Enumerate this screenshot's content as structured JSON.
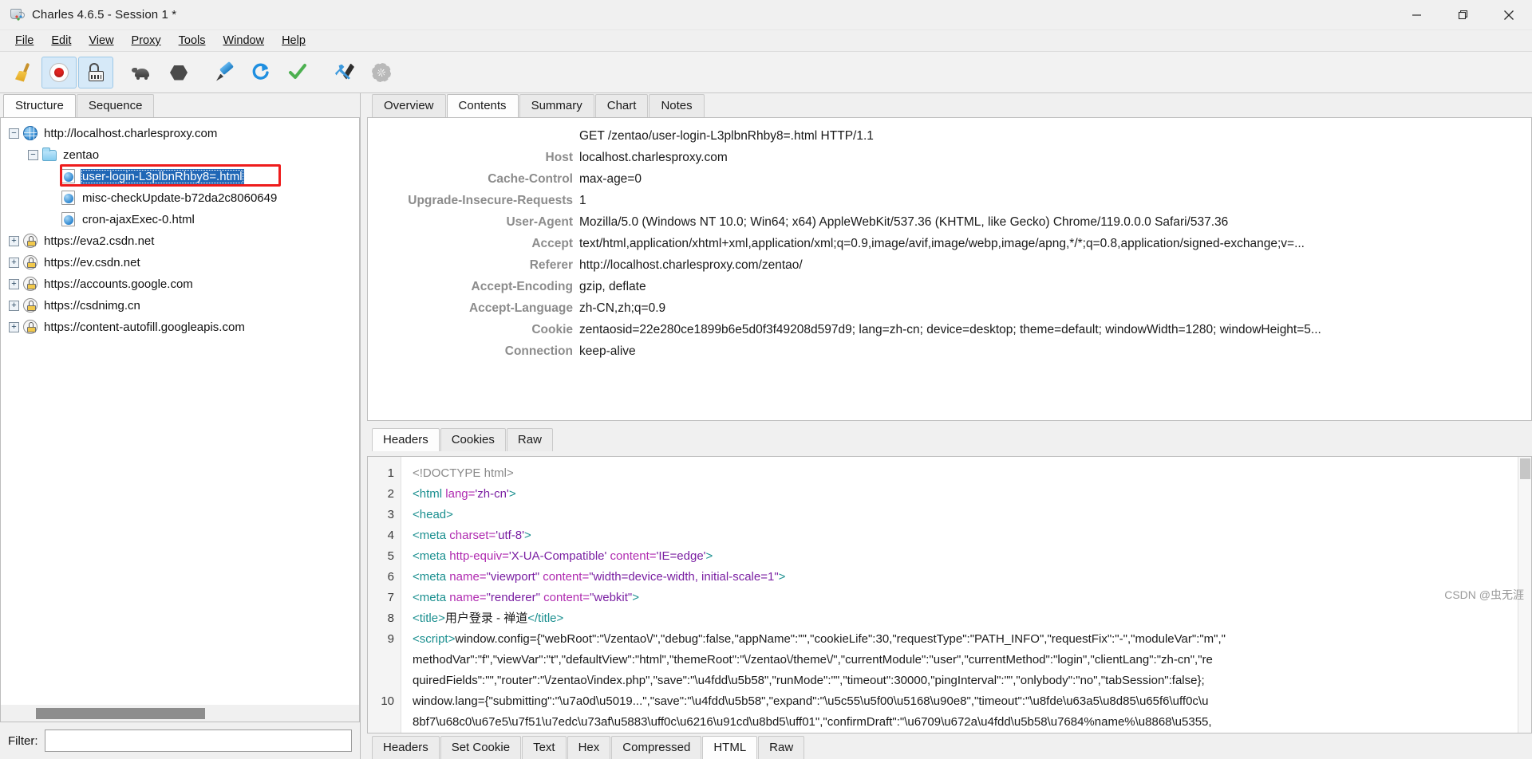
{
  "window": {
    "title": "Charles 4.6.5 - Session 1 *",
    "app_icon": "charles-cup-icon",
    "minimize_label": "Minimize",
    "maximize_label": "Restore",
    "close_label": "Close"
  },
  "menubar": [
    {
      "label": "File",
      "mnemonic": "F"
    },
    {
      "label": "Edit",
      "mnemonic": "E"
    },
    {
      "label": "View",
      "mnemonic": "V"
    },
    {
      "label": "Proxy",
      "mnemonic": "P"
    },
    {
      "label": "Tools",
      "mnemonic": "T"
    },
    {
      "label": "Window",
      "mnemonic": "W"
    },
    {
      "label": "Help",
      "mnemonic": "H"
    }
  ],
  "toolbar": [
    {
      "name": "clear-session-icon",
      "tip": "Clear the current session"
    },
    {
      "name": "record-icon",
      "tip": "Start/Stop Recording",
      "selected": true
    },
    {
      "name": "breakpoints-icon",
      "tip": "Enable/Disable Breakpoints",
      "selected": true
    },
    {
      "name": "throttle-icon",
      "tip": "Start/Stop Throttling"
    },
    {
      "name": "no-caching-icon",
      "tip": "Compose"
    },
    {
      "name": "compose-icon",
      "tip": "Compose a new request"
    },
    {
      "name": "repeat-icon",
      "tip": "Repeat the selected request"
    },
    {
      "name": "validate-icon",
      "tip": "Validate"
    },
    {
      "name": "tools-icon",
      "tip": "Tools"
    },
    {
      "name": "settings-icon",
      "tip": "Settings"
    }
  ],
  "left_panel": {
    "tabs": [
      {
        "label": "Structure",
        "active": true
      },
      {
        "label": "Sequence",
        "active": false
      }
    ],
    "tree": [
      {
        "label": "http://localhost.charlesproxy.com",
        "icon": "globe-icon",
        "twisty": "minus",
        "indent": 0,
        "selected": false,
        "highlighted": false
      },
      {
        "label": "zentao",
        "icon": "folder-icon",
        "twisty": "minus",
        "indent": 1,
        "selected": false,
        "highlighted": false
      },
      {
        "label": "user-login-L3plbnRhby8=.html",
        "icon": "file-icon",
        "twisty": "none",
        "indent": 2,
        "selected": true,
        "highlighted": true
      },
      {
        "label": "misc-checkUpdate-b72da2c8060649",
        "icon": "file-icon",
        "twisty": "none",
        "indent": 2,
        "selected": false,
        "highlighted": false
      },
      {
        "label": "cron-ajaxExec-0.html",
        "icon": "file-icon",
        "twisty": "none",
        "indent": 2,
        "selected": false,
        "highlighted": false
      },
      {
        "label": "https://eva2.csdn.net",
        "icon": "ssl-icon",
        "twisty": "plus",
        "indent": 0,
        "selected": false,
        "highlighted": false
      },
      {
        "label": "https://ev.csdn.net",
        "icon": "ssl-icon",
        "twisty": "plus",
        "indent": 0,
        "selected": false,
        "highlighted": false
      },
      {
        "label": "https://accounts.google.com",
        "icon": "ssl-icon",
        "twisty": "plus",
        "indent": 0,
        "selected": false,
        "highlighted": false
      },
      {
        "label": "https://csdnimg.cn",
        "icon": "ssl-icon",
        "twisty": "plus",
        "indent": 0,
        "selected": false,
        "highlighted": false
      },
      {
        "label": "https://content-autofill.googleapis.com",
        "icon": "ssl-icon",
        "twisty": "plus",
        "indent": 0,
        "selected": false,
        "highlighted": false
      }
    ],
    "filter": {
      "label": "Filter:",
      "value": "",
      "placeholder": ""
    }
  },
  "right_panel": {
    "main_tabs": [
      {
        "label": "Overview",
        "active": false
      },
      {
        "label": "Contents",
        "active": true
      },
      {
        "label": "Summary",
        "active": false
      },
      {
        "label": "Chart",
        "active": false
      },
      {
        "label": "Notes",
        "active": false
      }
    ],
    "request_line": "GET /zentao/user-login-L3plbnRhby8=.html HTTP/1.1",
    "headers": [
      {
        "name": "Host",
        "value": "localhost.charlesproxy.com"
      },
      {
        "name": "Cache-Control",
        "value": "max-age=0"
      },
      {
        "name": "Upgrade-Insecure-Requests",
        "value": "1"
      },
      {
        "name": "User-Agent",
        "value": "Mozilla/5.0 (Windows NT 10.0; Win64; x64) AppleWebKit/537.36 (KHTML, like Gecko) Chrome/119.0.0.0 Safari/537.36"
      },
      {
        "name": "Accept",
        "value": "text/html,application/xhtml+xml,application/xml;q=0.9,image/avif,image/webp,image/apng,*/*;q=0.8,application/signed-exchange;v=..."
      },
      {
        "name": "Referer",
        "value": "http://localhost.charlesproxy.com/zentao/"
      },
      {
        "name": "Accept-Encoding",
        "value": "gzip, deflate"
      },
      {
        "name": "Accept-Language",
        "value": "zh-CN,zh;q=0.9"
      },
      {
        "name": "Cookie",
        "value": "zentaosid=22e280ce1899b6e5d0f3f49208d597d9; lang=zh-cn; device=desktop; theme=default; windowWidth=1280; windowHeight=5..."
      },
      {
        "name": "Connection",
        "value": "keep-alive"
      }
    ],
    "request_subtabs": [
      {
        "label": "Headers",
        "active": true
      },
      {
        "label": "Cookies",
        "active": false
      },
      {
        "label": "Raw",
        "active": false
      }
    ],
    "response_subtabs": [
      {
        "label": "Headers",
        "active": false
      },
      {
        "label": "Set Cookie",
        "active": false
      },
      {
        "label": "Text",
        "active": false
      },
      {
        "label": "Hex",
        "active": false
      },
      {
        "label": "Compressed",
        "active": false
      },
      {
        "label": "HTML",
        "active": true
      },
      {
        "label": "Raw",
        "active": false
      }
    ],
    "code_lines": [
      {
        "num": "1",
        "segments": [
          {
            "t": "<!DOCTYPE html>",
            "c": "gy"
          }
        ]
      },
      {
        "num": "2",
        "segments": [
          {
            "t": "<html ",
            "c": "tg"
          },
          {
            "t": "lang=",
            "c": "at"
          },
          {
            "t": "'zh-cn'",
            "c": "st"
          },
          {
            "t": ">",
            "c": "tg"
          }
        ]
      },
      {
        "num": "3",
        "segments": [
          {
            "t": "<head>",
            "c": "tg"
          }
        ]
      },
      {
        "num": "4",
        "segments": [
          {
            "t": "  <meta ",
            "c": "tg"
          },
          {
            "t": "charset=",
            "c": "at"
          },
          {
            "t": "'utf-8'",
            "c": "st"
          },
          {
            "t": ">",
            "c": "tg"
          }
        ]
      },
      {
        "num": "5",
        "segments": [
          {
            "t": " <meta ",
            "c": "tg"
          },
          {
            "t": "http-equiv=",
            "c": "at"
          },
          {
            "t": "'X-UA-Compatible'",
            "c": "st"
          },
          {
            "t": " content=",
            "c": "at"
          },
          {
            "t": "'IE=edge'",
            "c": "st"
          },
          {
            "t": ">",
            "c": "tg"
          }
        ]
      },
      {
        "num": "6",
        "segments": [
          {
            "t": " <meta ",
            "c": "tg"
          },
          {
            "t": "name=",
            "c": "at"
          },
          {
            "t": "\"viewport\"",
            "c": "st"
          },
          {
            "t": " content=",
            "c": "at"
          },
          {
            "t": "\"width=device-width, initial-scale=1\"",
            "c": "st"
          },
          {
            "t": ">",
            "c": "tg"
          }
        ]
      },
      {
        "num": "7",
        "segments": [
          {
            "t": " <meta ",
            "c": "tg"
          },
          {
            "t": "name=",
            "c": "at"
          },
          {
            "t": "\"renderer\"",
            "c": "st"
          },
          {
            "t": " content=",
            "c": "at"
          },
          {
            "t": "\"webkit\"",
            "c": "st"
          },
          {
            "t": ">",
            "c": "tg"
          }
        ]
      },
      {
        "num": "8",
        "segments": [
          {
            "t": " <title>",
            "c": "tg"
          },
          {
            "t": "用户登录 - 禅道",
            "c": "pl"
          },
          {
            "t": "</title>",
            "c": "tg"
          }
        ]
      },
      {
        "num": "9",
        "segments": [
          {
            "t": "<script>",
            "c": "tg"
          },
          {
            "t": "window.config={\"webRoot\":\"\\/zentao\\/\",\"debug\":false,\"appName\":\"\",\"cookieLife\":30,\"requestType\":\"PATH_INFO\",\"requestFix\":\"-\",\"moduleVar\":\"m\",\"",
            "c": "pl"
          }
        ]
      },
      {
        "num": "",
        "segments": [
          {
            "t": "methodVar\":\"f\",\"viewVar\":\"t\",\"defaultView\":\"html\",\"themeRoot\":\"\\/zentao\\/theme\\/\",\"currentModule\":\"user\",\"currentMethod\":\"login\",\"clientLang\":\"zh-cn\",\"re",
            "c": "pl"
          }
        ]
      },
      {
        "num": "",
        "segments": [
          {
            "t": "quiredFields\":\"\",\"router\":\"\\/zentao\\/index.php\",\"save\":\"\\u4fdd\\u5b58\",\"runMode\":\"\",\"timeout\":30000,\"pingInterval\":\"\",\"onlybody\":\"no\",\"tabSession\":false};",
            "c": "pl"
          }
        ]
      },
      {
        "num": "10",
        "segments": [
          {
            "t": "window.lang={\"submitting\":\"\\u7a0d\\u5019...\",\"save\":\"\\u4fdd\\u5b58\",\"expand\":\"\\u5c55\\u5f00\\u5168\\u90e8\",\"timeout\":\"\\u8fde\\u63a5\\u8d85\\u65f6\\uff0c\\u",
            "c": "pl"
          }
        ]
      },
      {
        "num": "",
        "segments": [
          {
            "t": "8bf7\\u68c0\\u67e5\\u7f51\\u7edc\\u73af\\u5883\\uff0c\\u6216\\u91cd\\u8bd5\\uff01\",\"confirmDraft\":\"\\u6709\\u672a\\u4fdd\\u5b58\\u7684%name%\\u8868\\u5355,",
            "c": "pl"
          }
        ]
      }
    ],
    "watermark": "CSDN @虫无涯"
  }
}
